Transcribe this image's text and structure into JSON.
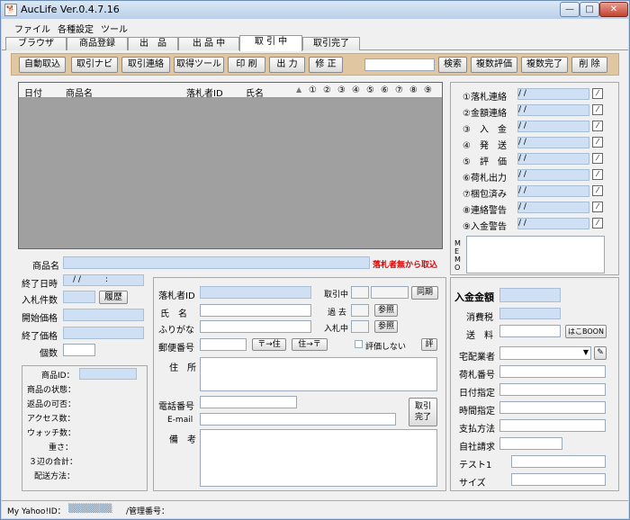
{
  "window": {
    "title": "AucLife Ver.0.4.7.16",
    "app_icon": "🐕",
    "min": "—",
    "max": "□",
    "close": "✕"
  },
  "menu": [
    "ファイル",
    "各種設定",
    "ツール"
  ],
  "tabs": [
    "ブラウザ",
    "商品登録",
    "出　品",
    "出 品 中",
    "取 引 中",
    "取引完了"
  ],
  "toolbar": {
    "buttons": [
      "自動取込",
      "取引ナビ",
      "取引連絡",
      "取得ツール",
      "印 刷",
      "出 力",
      "修 正"
    ],
    "search_value": "",
    "search_button": "検索",
    "multi_eval": "複数評価",
    "multi_done": "複数完了",
    "delete": "削 除"
  },
  "grid": {
    "headers": [
      "日付",
      "商品名",
      "落札者ID",
      "氏名"
    ],
    "sort_arrow": "▲",
    "steps_header": [
      "①",
      "②",
      "③",
      "④",
      "⑤",
      "⑥",
      "⑦",
      "⑧",
      "⑨"
    ]
  },
  "steps": [
    {
      "label": "①落札連絡",
      "date": "/ /"
    },
    {
      "label": "②金額連絡",
      "date": "/ /"
    },
    {
      "label": "③　入　金",
      "date": "/ /"
    },
    {
      "label": "④　発　送",
      "date": "/ /"
    },
    {
      "label": "⑤　評　価",
      "date": "/ /"
    },
    {
      "label": "⑥荷札出力",
      "date": "/ /"
    },
    {
      "label": "⑦梱包済み",
      "date": "/ /"
    },
    {
      "label": "⑧連絡警告",
      "date": "/ /"
    },
    {
      "label": "⑨入金警告",
      "date": "/ /"
    }
  ],
  "memo_label": "MEMO",
  "product": {
    "name_label": "商品名",
    "no_winner_notice": "落札者無から取込",
    "end_date_label": "終了日時",
    "end_date_value": "/ /",
    "end_time_value": ":",
    "bids_label": "入札件数",
    "history": "履歴",
    "start_price": "開始価格",
    "end_price": "終了価格",
    "count": "個数"
  },
  "details": {
    "id_label": "商品ID：",
    "items": [
      "商品の状態：",
      "返品の可否：",
      "アクセス数：",
      "ウォッチ数：",
      "重さ：",
      "３辺の合計：",
      "配送方法："
    ]
  },
  "buyer": {
    "id": "落札者ID",
    "trading": "取引中",
    "sync": "同期",
    "name": "氏　名",
    "past": "過 去",
    "kana": "ふりがな",
    "bidding": "入札中",
    "ref": "参照",
    "zip": "郵便番号",
    "zip_to_addr": "〒→住",
    "addr_to_zip": "住→〒",
    "no_eval": "評価しない",
    "eval": "評",
    "address": "住　所",
    "phone": "電話番号",
    "done_btn": "取引\n完了",
    "email": "E-mail",
    "remarks": "備　考"
  },
  "payment": {
    "total": "入金金額",
    "tax": "消費税",
    "shipping": "送　料",
    "hakoboon": "はこBOON",
    "carrier": "宅配業者",
    "tracking": "荷札番号",
    "date": "日付指定",
    "time": "時間指定",
    "method": "支払方法",
    "own_charge": "自社請求",
    "test1": "テスト1",
    "size": "サイズ"
  },
  "status": {
    "yahoo_label": "My Yahoo!ID：",
    "yahoo_value": "▒▒▒▒▒▒▒",
    "mgmt_label": "/管理番号："
  }
}
